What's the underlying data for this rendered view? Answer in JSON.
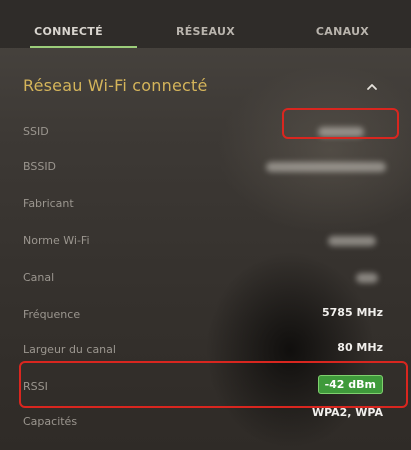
{
  "tabs": [
    {
      "label": "CONNECTÉ",
      "active": true
    },
    {
      "label": "RÉSEAUX",
      "active": false
    },
    {
      "label": "CANAUX",
      "active": false
    }
  ],
  "section": {
    "title": "Réseau Wi-Fi connecté",
    "collapse_icon": "chevron-up-icon"
  },
  "rows": {
    "ssid": {
      "label": "SSID"
    },
    "bssid": {
      "label": "BSSID"
    },
    "fabricant": {
      "label": "Fabricant"
    },
    "norme": {
      "label": "Norme Wi-Fi"
    },
    "canal": {
      "label": "Canal"
    },
    "frequence": {
      "label": "Fréquence",
      "value": "5785 MHz"
    },
    "largeur": {
      "label": "Largeur du canal",
      "value": "80 MHz"
    },
    "rssi": {
      "label": "RSSI",
      "value": "-42 dBm"
    },
    "capacites": {
      "label": "Capacités",
      "value": "WPA2, WPA"
    }
  },
  "colors": {
    "accent_tab": "#9ccd7a",
    "section_title": "#d4b45a",
    "rssi_badge": "#3f9a3b",
    "highlight": "#d9261f"
  }
}
